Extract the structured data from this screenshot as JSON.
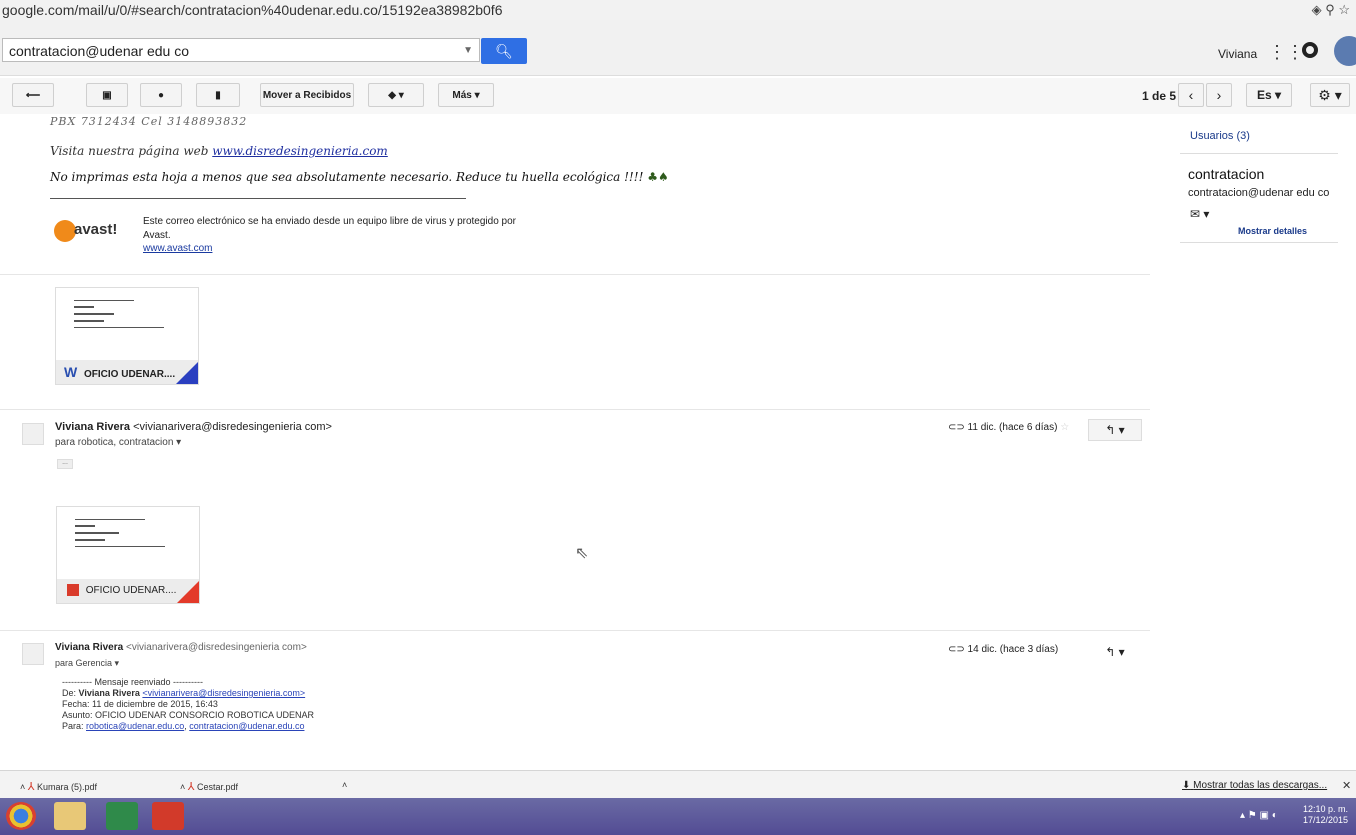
{
  "browser": {
    "url": "google.com/mail/u/0/#search/contratacion%40udenar.edu.co/15192ea38982b0f6"
  },
  "header": {
    "search_value": "contratacion@udenar edu co",
    "user_name": "Viviana"
  },
  "toolbar": {
    "move_label": "Mover a Recibidos",
    "more_label": "Más",
    "pager": "1 de 5",
    "lang": "Es"
  },
  "side_panel": {
    "users": "Usuarios (3)",
    "contact_name": "contratacion",
    "contact_email": "contratacion@udenar edu co",
    "details": "Mostrar detalles"
  },
  "signature": {
    "pbx": "PBX 7312434 Cel 3148893832",
    "web_text": "Visita nuestra página web ",
    "web_link": "www.disredesingenieria.com",
    "eco": "No imprimas esta hoja a menos que sea absolutamente necesario. Reduce tu huella ecológica !!!!",
    "avast_logo": "avast!",
    "avast_text": "Este correo electrónico se ha enviado desde un equipo libre de virus y protegido por Avast.",
    "avast_link": "www.avast.com"
  },
  "attachments": [
    {
      "name": "OFICIO UDENAR....",
      "icon": "word-icon"
    },
    {
      "name": "OFICIO UDENAR....",
      "icon": "pdf-icon"
    }
  ],
  "messages": [
    {
      "from_name": "Viviana Rivera",
      "from_email": "<vivianarivera@disredesingenieria com>",
      "to": "para robotica, contratacion",
      "date": "11 dic. (hace 6 días)",
      "trimmed": "..."
    },
    {
      "from_name": "Viviana Rivera",
      "from_email": "<vivianarivera@disredesingenieria com>",
      "to": "para Gerencia",
      "date": "14 dic. (hace 3 días)",
      "fwd_header": "---------- Mensaje reenviado ----------",
      "fwd_from_label": "De: ",
      "fwd_from_name": "Viviana Rivera",
      "fwd_from_email": "<vivianarivera@disredesingenieria.com>",
      "fwd_date": "Fecha: 11 de diciembre de 2015, 16:43",
      "fwd_subject": "Asunto: OFICIO UDENAR CONSORCIO ROBOTICA UDENAR",
      "fwd_to_label": "Para: ",
      "fwd_to_1": "robotica@udenar.edu.co",
      "fwd_to_2": "contratacion@udenar.edu.co"
    }
  ],
  "downloads": {
    "items": [
      "Kumara (5).pdf",
      "Cestar.pdf"
    ],
    "show_all": "Mostrar todas las descargas..."
  },
  "taskbar": {
    "time": "12:10 p. m.",
    "date": "17/12/2015"
  }
}
